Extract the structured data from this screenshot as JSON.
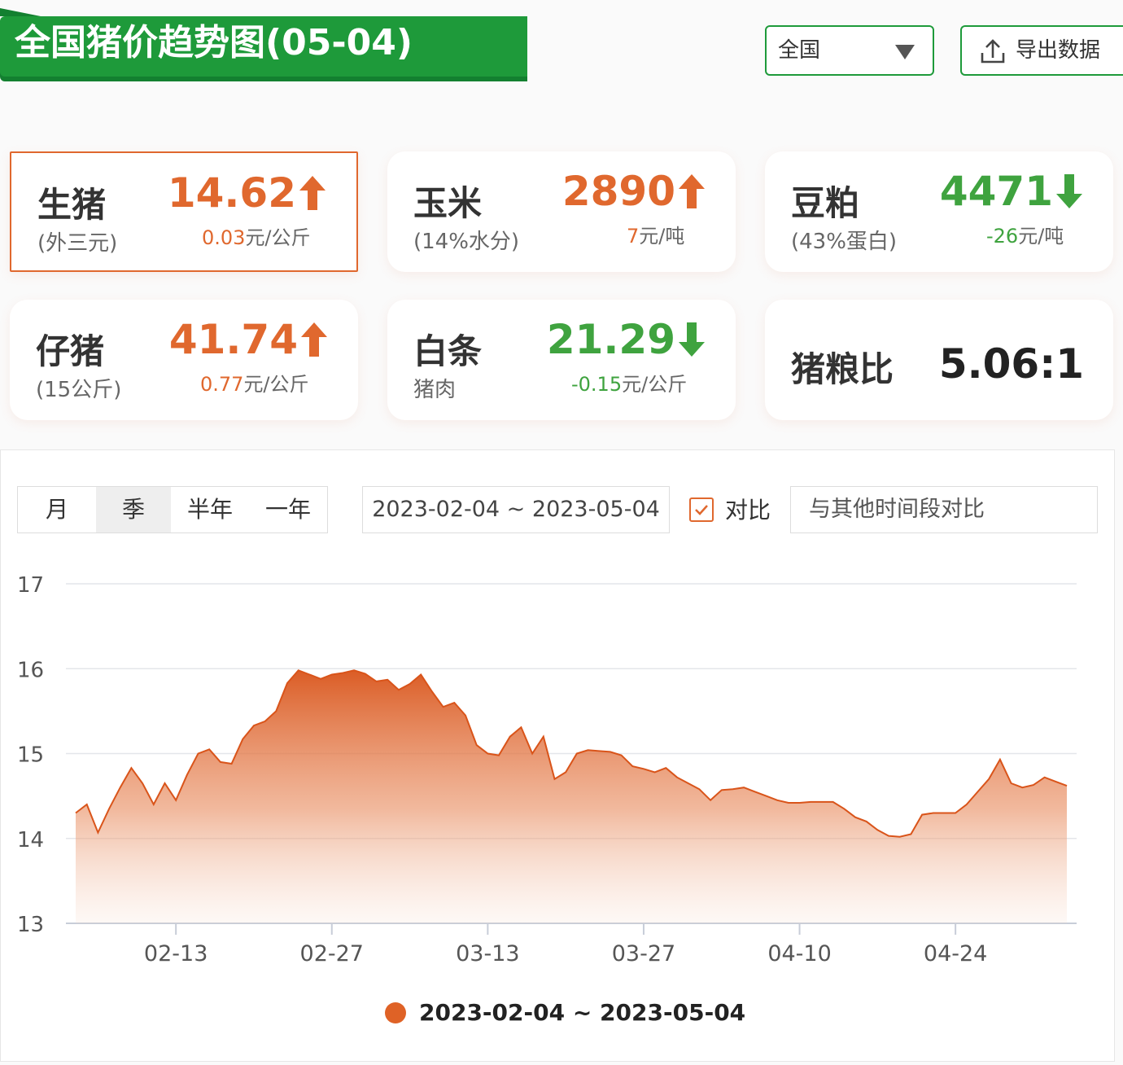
{
  "header": {
    "title": "全国猪价趋势图(05-04)",
    "region": "全国",
    "export_label": "导出数据"
  },
  "cards": [
    {
      "name": "生猪",
      "sub": "(外三元)",
      "value": "14.62",
      "direction": "up",
      "change": "0.03",
      "unit": "元/公斤"
    },
    {
      "name": "玉米",
      "sub": "(14%水分)",
      "value": "2890",
      "direction": "up",
      "change": "7",
      "unit": "元/吨"
    },
    {
      "name": "豆粕",
      "sub": "(43%蛋白)",
      "value": "4471",
      "direction": "down",
      "change": "-26",
      "unit": "元/吨"
    },
    {
      "name": "仔猪",
      "sub": "(15公斤)",
      "value": "41.74",
      "direction": "up",
      "change": "0.77",
      "unit": "元/公斤"
    },
    {
      "name": "白条",
      "sub": "猪肉",
      "value": "21.29",
      "direction": "down",
      "change": "-0.15",
      "unit": "元/公斤"
    }
  ],
  "ratio": {
    "name": "猪粮比",
    "value": "5.06:1"
  },
  "controls": {
    "tabs": [
      "月",
      "季",
      "半年",
      "一年"
    ],
    "selected_tab": "季",
    "date_range": "2023-02-04 ~ 2023-05-04",
    "compare_label": "对比",
    "compare_placeholder": "与其他时间段对比"
  },
  "colors": {
    "accent": "#df6226",
    "green": "#1e9a3a",
    "down": "#3fa33f"
  },
  "chart_data": {
    "type": "area",
    "title": "",
    "xlabel": "",
    "ylabel": "",
    "ylim": [
      13,
      17
    ],
    "yticks": [
      13,
      14,
      15,
      16,
      17
    ],
    "xticks": [
      "02-13",
      "02-27",
      "03-13",
      "03-27",
      "04-10",
      "04-24"
    ],
    "grid": true,
    "legend_position": "bottom",
    "series": [
      {
        "name": "2023-02-04 ~ 2023-05-04",
        "x": [
          "02-04",
          "02-05",
          "02-06",
          "02-07",
          "02-08",
          "02-09",
          "02-10",
          "02-11",
          "02-12",
          "02-13",
          "02-14",
          "02-15",
          "02-16",
          "02-17",
          "02-18",
          "02-19",
          "02-20",
          "02-21",
          "02-22",
          "02-23",
          "02-24",
          "02-25",
          "02-26",
          "02-27",
          "02-28",
          "03-01",
          "03-02",
          "03-03",
          "03-04",
          "03-05",
          "03-06",
          "03-07",
          "03-08",
          "03-09",
          "03-10",
          "03-11",
          "03-12",
          "03-13",
          "03-14",
          "03-15",
          "03-16",
          "03-17",
          "03-18",
          "03-19",
          "03-20",
          "03-21",
          "03-22",
          "03-23",
          "03-24",
          "03-25",
          "03-26",
          "03-27",
          "03-28",
          "03-29",
          "03-30",
          "03-31",
          "04-01",
          "04-02",
          "04-03",
          "04-04",
          "04-05",
          "04-06",
          "04-07",
          "04-08",
          "04-09",
          "04-10",
          "04-11",
          "04-12",
          "04-13",
          "04-14",
          "04-15",
          "04-16",
          "04-17",
          "04-18",
          "04-19",
          "04-20",
          "04-21",
          "04-22",
          "04-23",
          "04-24",
          "04-25",
          "04-26",
          "04-27",
          "04-28",
          "04-29",
          "04-30",
          "05-01",
          "05-02",
          "05-03",
          "05-04"
        ],
        "values": [
          14.3,
          14.4,
          14.07,
          14.35,
          14.6,
          14.83,
          14.65,
          14.4,
          14.65,
          14.45,
          14.75,
          15.0,
          15.05,
          14.9,
          14.88,
          15.17,
          15.33,
          15.38,
          15.5,
          15.83,
          15.98,
          15.93,
          15.88,
          15.93,
          15.95,
          15.98,
          15.94,
          15.85,
          15.87,
          15.75,
          15.82,
          15.93,
          15.73,
          15.55,
          15.6,
          15.45,
          15.1,
          15.0,
          14.98,
          15.2,
          15.31,
          15.0,
          15.2,
          14.7,
          14.78,
          15.0,
          15.04,
          15.03,
          15.02,
          14.98,
          14.85,
          14.82,
          14.78,
          14.83,
          14.72,
          14.65,
          14.58,
          14.45,
          14.57,
          14.58,
          14.6,
          14.55,
          14.5,
          14.45,
          14.42,
          14.42,
          14.43,
          14.43,
          14.43,
          14.35,
          14.25,
          14.2,
          14.1,
          14.03,
          14.02,
          14.05,
          14.28,
          14.3,
          14.3,
          14.3,
          14.4,
          14.55,
          14.7,
          14.93,
          14.65,
          14.6,
          14.63,
          14.72,
          14.67,
          14.62
        ]
      }
    ]
  }
}
